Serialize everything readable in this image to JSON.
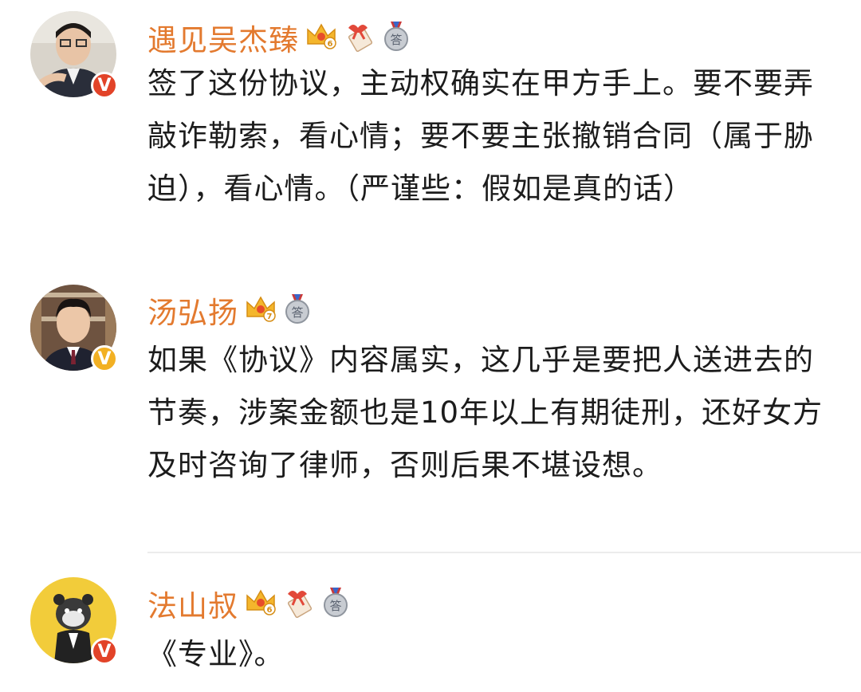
{
  "comments": [
    {
      "name": "遇见吴杰臻",
      "text": "签了这份协议，主动权确实在甲方手上。要不要弄敲诈勒索，看心情；要不要主张撤销合同（属于胁迫），看心情。（严谨些：假如是真的话）",
      "verified": "V",
      "verified_color": "#e24328",
      "crown_level": "6",
      "badges": [
        "crown-icon",
        "gift-icon",
        "answer-medal-icon"
      ]
    },
    {
      "name": "汤弘扬",
      "text": "如果《协议》内容属实，这几乎是要把人送进去的节奏，涉案金额也是10年以上有期徒刑，还好女方及时咨询了律师，否则后果不堪设想。",
      "verified": "V",
      "verified_color": "#f2b023",
      "crown_level": "7",
      "badges": [
        "crown-icon",
        "answer-medal-icon"
      ]
    },
    {
      "name": "法山叔",
      "text": "《专业》。",
      "verified": "V",
      "verified_color": "#e24328",
      "crown_level": "6",
      "badges": [
        "crown-icon",
        "gift-icon",
        "answer-medal-icon"
      ]
    }
  ],
  "medal_char": "答"
}
